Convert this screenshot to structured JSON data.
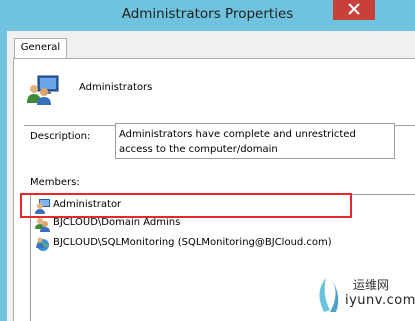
{
  "window": {
    "title": "Administrators Properties"
  },
  "tabs": [
    {
      "label": "General"
    }
  ],
  "group": {
    "name": "Administrators"
  },
  "description": {
    "label": "Description:",
    "value": "Administrators have complete and unrestricted access to the computer/domain"
  },
  "members": {
    "label": "Members:",
    "items": [
      {
        "name": "Administrator",
        "icon": "user-icon"
      },
      {
        "name": "BJCLOUD\\Domain Admins",
        "icon": "group-icon"
      },
      {
        "name": "BJCLOUD\\SQLMonitoring (SQLMonitoring@BJCloud.com)",
        "icon": "user-globe-icon"
      }
    ]
  },
  "watermark": {
    "line1": "运维网",
    "line2": "iyunv.com"
  },
  "colors": {
    "titlebar": "#6fc3df",
    "close_button": "#c7403a",
    "highlight_border": "#e8262b"
  }
}
